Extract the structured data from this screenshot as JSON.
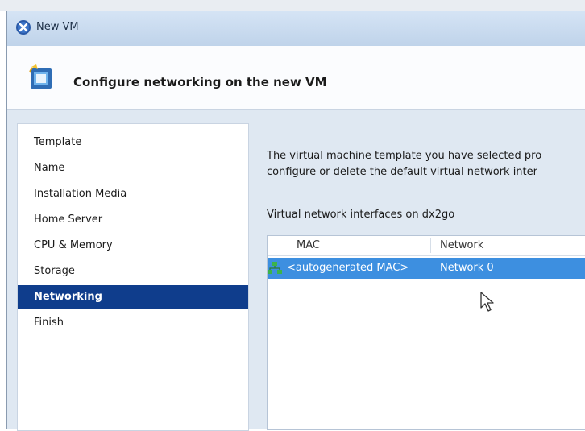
{
  "window": {
    "title": "New VM"
  },
  "header": {
    "title": "Configure networking on the new VM"
  },
  "sidebar": {
    "items": [
      {
        "label": "Template",
        "active": false
      },
      {
        "label": "Name",
        "active": false
      },
      {
        "label": "Installation Media",
        "active": false
      },
      {
        "label": "Home Server",
        "active": false
      },
      {
        "label": "CPU & Memory",
        "active": false
      },
      {
        "label": "Storage",
        "active": false
      },
      {
        "label": "Networking",
        "active": true
      },
      {
        "label": "Finish",
        "active": false
      }
    ]
  },
  "content": {
    "description_line1": "The virtual machine template you have selected pro",
    "description_line2": "configure or delete the default virtual network inter",
    "interfaces_label": "Virtual network interfaces on dx2go",
    "table": {
      "columns": [
        "MAC",
        "Network"
      ],
      "rows": [
        {
          "mac": "<autogenerated MAC>",
          "network": "Network 0",
          "selected": true
        }
      ]
    }
  },
  "colors": {
    "accent_active": "#0f3d8c",
    "row_selected": "#3d8fe0",
    "window_bg": "#dfe8f2"
  },
  "icons": {
    "title": "xen-logo-icon",
    "header": "vm-wizard-icon",
    "row": "network-interface-icon",
    "cursor": "mouse-pointer-icon"
  }
}
